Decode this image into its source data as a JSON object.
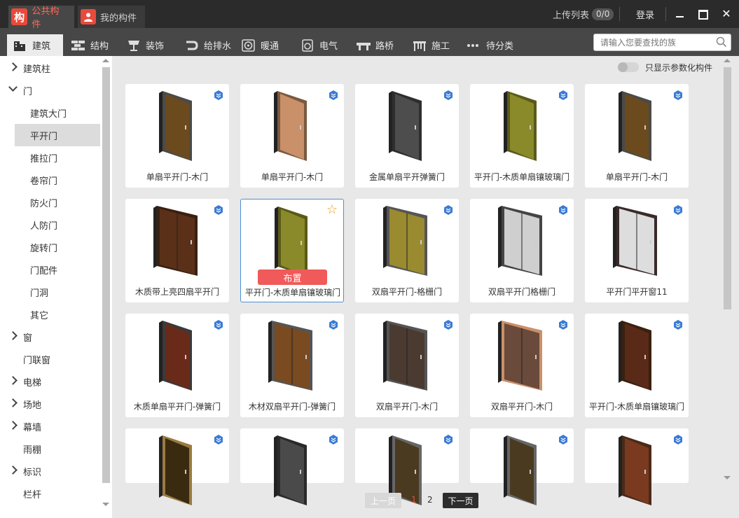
{
  "top_tabs": {
    "public": "公共构件",
    "mine": "我的构件"
  },
  "header_right": {
    "upload_list": "上传列表",
    "upload_count": "0/0",
    "login": "登录"
  },
  "categories": [
    {
      "label": "建筑",
      "icon": "building-icon"
    },
    {
      "label": "结构",
      "icon": "brick-icon"
    },
    {
      "label": "装饰",
      "icon": "lamp-icon"
    },
    {
      "label": "给排水",
      "icon": "pipe-icon"
    },
    {
      "label": "暖通",
      "icon": "fan-icon"
    },
    {
      "label": "电气",
      "icon": "socket-icon"
    },
    {
      "label": "路桥",
      "icon": "bridge-icon"
    },
    {
      "label": "施工",
      "icon": "scaffold-icon"
    },
    {
      "label": "待分类",
      "icon": "more-dots-icon"
    }
  ],
  "search": {
    "placeholder": "请输入您要查找的族"
  },
  "sidebar": [
    {
      "label": "建筑柱",
      "level": 0,
      "chevron": "right"
    },
    {
      "label": "门",
      "level": 0,
      "chevron": "down"
    },
    {
      "label": "建筑大门",
      "level": 1
    },
    {
      "label": "平开门",
      "level": 1,
      "selected": true
    },
    {
      "label": "推拉门",
      "level": 1
    },
    {
      "label": "卷帘门",
      "level": 1
    },
    {
      "label": "防火门",
      "level": 1
    },
    {
      "label": "人防门",
      "level": 1
    },
    {
      "label": "旋转门",
      "level": 1
    },
    {
      "label": "门配件",
      "level": 1
    },
    {
      "label": "门洞",
      "level": 1
    },
    {
      "label": "其它",
      "level": 1
    },
    {
      "label": "窗",
      "level": 0,
      "chevron": "right"
    },
    {
      "label": "门联窗",
      "level": 0
    },
    {
      "label": "电梯",
      "level": 0,
      "chevron": "right"
    },
    {
      "label": "场地",
      "level": 0,
      "chevron": "right"
    },
    {
      "label": "幕墙",
      "level": 0,
      "chevron": "right"
    },
    {
      "label": "雨棚",
      "level": 0
    },
    {
      "label": "标识",
      "level": 0,
      "chevron": "right"
    },
    {
      "label": "栏杆",
      "level": 0
    }
  ],
  "param_filter_label": "只显示参数化构件",
  "place_button": "布置",
  "items": [
    {
      "label": "单扇平开门-木门",
      "color": "#6b4a1e",
      "frame": "#4a4a4a"
    },
    {
      "label": "单扇平开门-木门",
      "color": "#c9906a",
      "frame": "#7a5a40"
    },
    {
      "label": "金属单扇平开弹簧门",
      "color": "#4d4d4d",
      "frame": "#2e2e2e"
    },
    {
      "label": "平开门-木质单扇镶玻璃门",
      "color": "#8a8a2a",
      "frame": "#5a5a1a"
    },
    {
      "label": "单扇平开门-木门",
      "color": "#6b4a1e",
      "frame": "#4a4a4a"
    },
    {
      "label": "木质带上亮四扇平开门",
      "color": "#5a3018",
      "frame": "#3a2010"
    },
    {
      "label": "平开门-木质单扇镶玻璃门",
      "color": "#8a8a2a",
      "frame": "#5a5a1a"
    },
    {
      "label": "双扇平开门-格栅门",
      "color": "#9a8a30",
      "frame": "#555555"
    },
    {
      "label": "双扇平开门格栅门",
      "color": "#cfcfcf",
      "frame": "#444444"
    },
    {
      "label": "平开门平开窗11",
      "color": "#dddddd",
      "frame": "#3a2a2a"
    },
    {
      "label": "木质单扇平开门-弹簧门",
      "color": "#6a2a1a",
      "frame": "#3a3a3a"
    },
    {
      "label": "木材双扇平开门-弹簧门",
      "color": "#7a4a20",
      "frame": "#555555"
    },
    {
      "label": "双扇平开门-木门",
      "color": "#4a3a30",
      "frame": "#555555"
    },
    {
      "label": "双扇平开门-木门",
      "color": "#6a4a3a",
      "frame": "#c9906a"
    },
    {
      "label": "平开门-木质单扇镶玻璃门",
      "color": "#5a2a18",
      "frame": "#3a2010"
    },
    {
      "label": "",
      "color": "#3a2a10",
      "frame": "#9a7a40"
    },
    {
      "label": "",
      "color": "#4a4a4a",
      "frame": "#2a2a2a"
    },
    {
      "label": "",
      "color": "#4a3a20",
      "frame": "#666666"
    },
    {
      "label": "",
      "color": "#4a3a20",
      "frame": "#666666"
    },
    {
      "label": "",
      "color": "#7a3a20",
      "frame": "#4a2a18"
    }
  ],
  "pagination": {
    "prev": "上一页",
    "current": "1",
    "other": "2",
    "next": "下一页"
  }
}
